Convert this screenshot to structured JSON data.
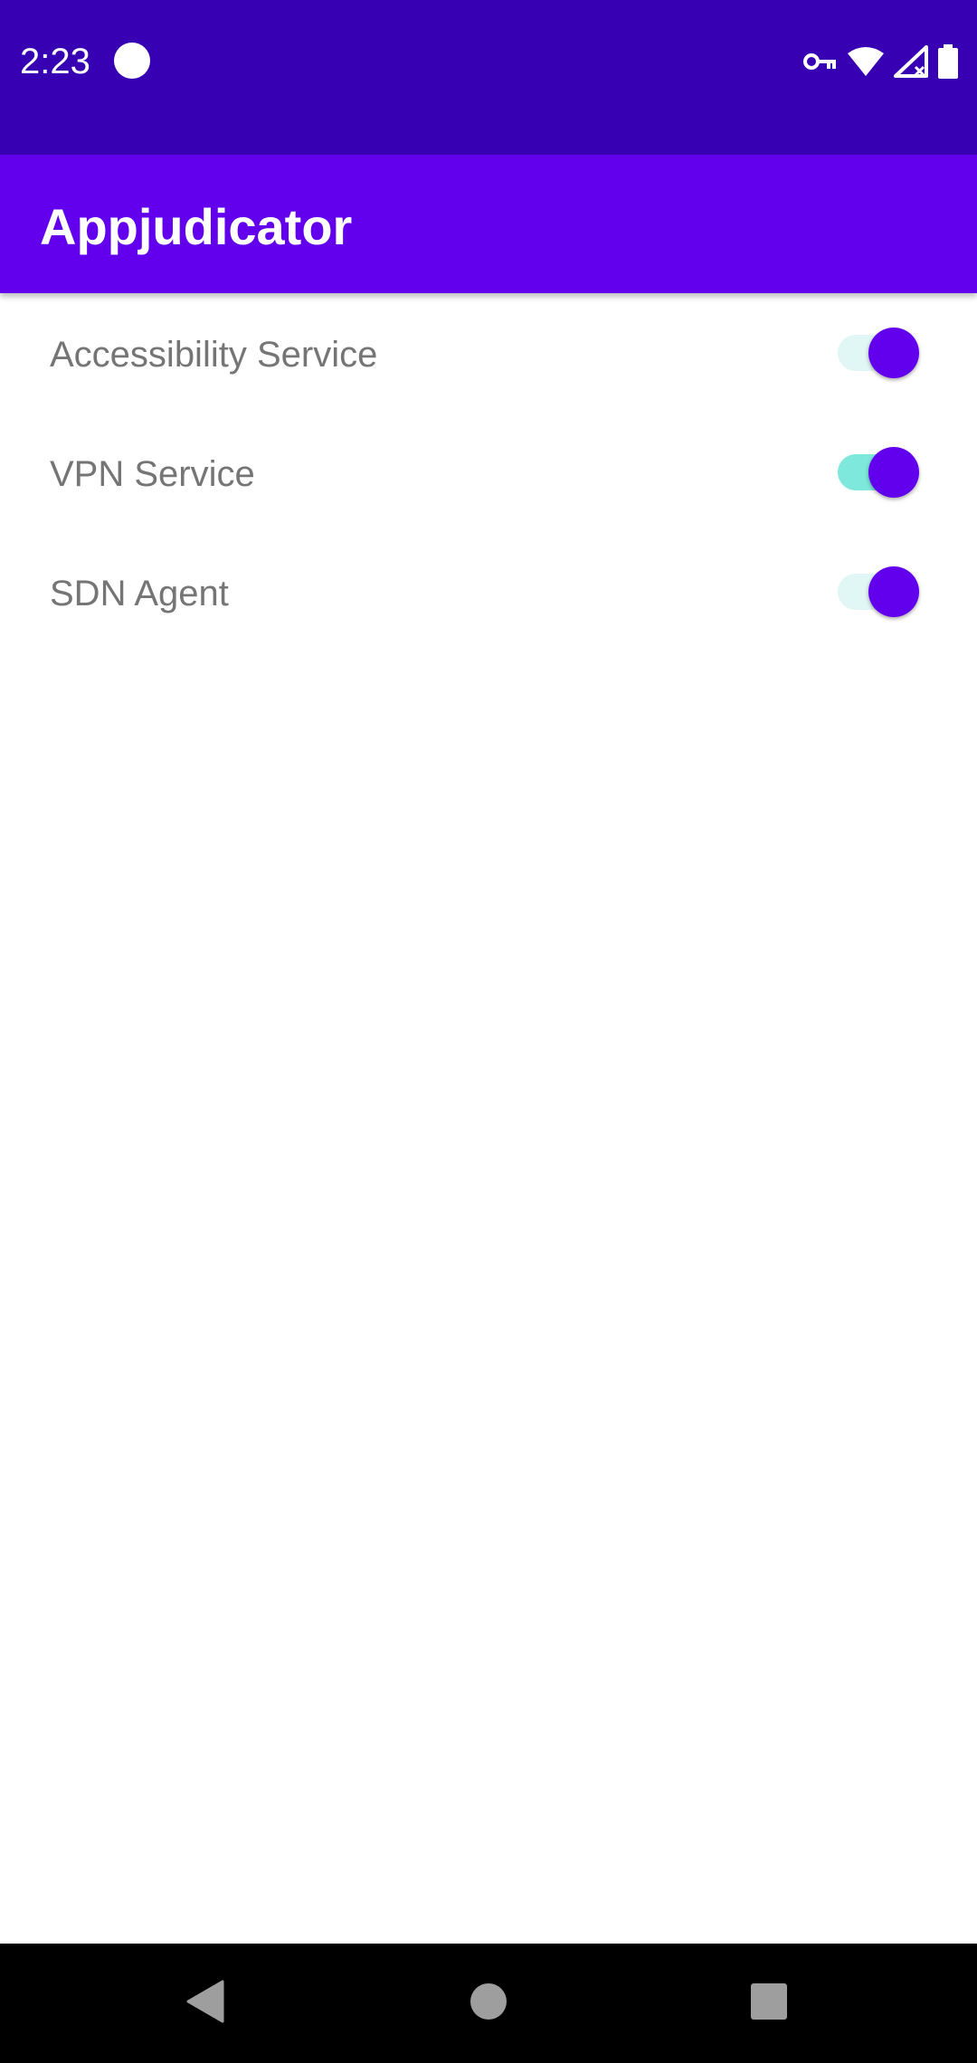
{
  "status_bar": {
    "time": "2:23",
    "background": "#3700b3",
    "icons": [
      "notification-dot-icon",
      "vpn-key-icon",
      "wifi-icon",
      "cellular-no-signal-icon",
      "battery-icon"
    ]
  },
  "app_bar": {
    "title": "Appjudicator",
    "background": "#6200ee"
  },
  "settings": [
    {
      "label": "Accessibility Service",
      "checked": true
    },
    {
      "label": "VPN Service",
      "checked": true
    },
    {
      "label": "SDN Agent",
      "checked": true
    }
  ],
  "colors": {
    "accent": "#6200ee",
    "track_light": "#e0f7f5",
    "track_active": "#7ee8dc",
    "label_text": "#757575"
  },
  "nav_bar": {
    "icons": [
      "back-icon",
      "home-icon",
      "recents-icon"
    ]
  }
}
